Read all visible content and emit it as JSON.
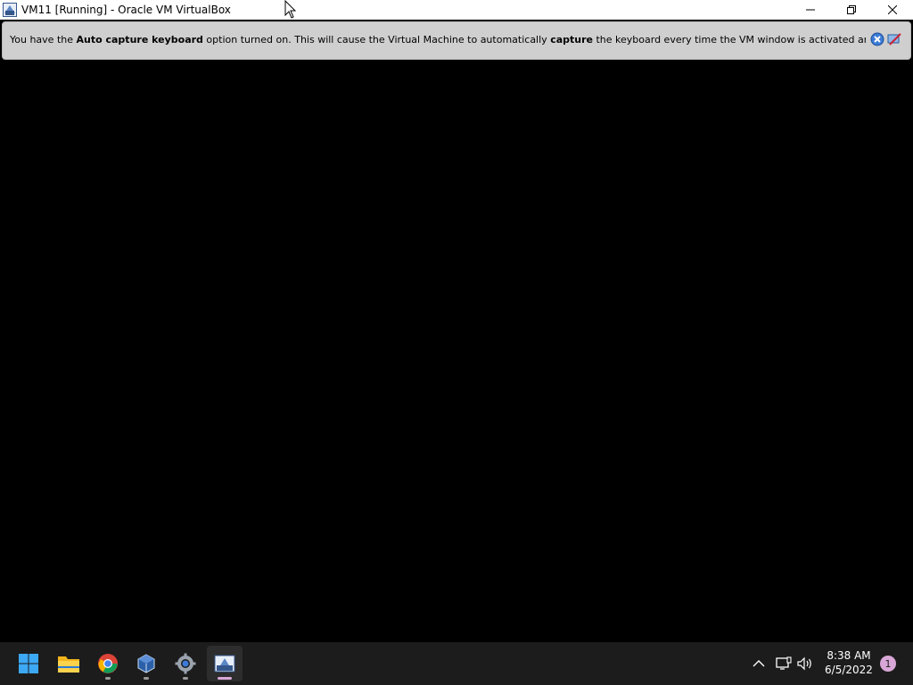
{
  "window": {
    "title": "VM11 [Running] - Oracle VM VirtualBox",
    "controls": [
      "minimize",
      "maximize",
      "close"
    ]
  },
  "notice": {
    "part1": "You have the ",
    "bold1": "Auto capture keyboard",
    "part2": " option turned on. This will cause the Virtual Machine to automatically ",
    "bold2": "capture",
    "part3": " the keyboard every time the VM window is activated and make it unavailable to",
    "close_icon": "close-icon",
    "dont_show_icon": "dont-show-icon"
  },
  "taskbar": {
    "apps": [
      {
        "name": "start",
        "icon": "windows-start-icon"
      },
      {
        "name": "file-explorer",
        "icon": "folder-icon"
      },
      {
        "name": "chrome",
        "icon": "chrome-icon"
      },
      {
        "name": "virtualbox",
        "icon": "virtualbox-icon"
      },
      {
        "name": "settings",
        "icon": "gear-icon"
      },
      {
        "name": "vm11",
        "icon": "vm-window-icon"
      }
    ],
    "tray": {
      "clock_time": "8:38 AM",
      "clock_date": "6/5/2022",
      "notification_count": "1"
    }
  },
  "colors": {
    "accent": "#d9a7d7",
    "notice_bg": "#cfcfcf",
    "taskbar_bg": "#1c1c1c"
  }
}
